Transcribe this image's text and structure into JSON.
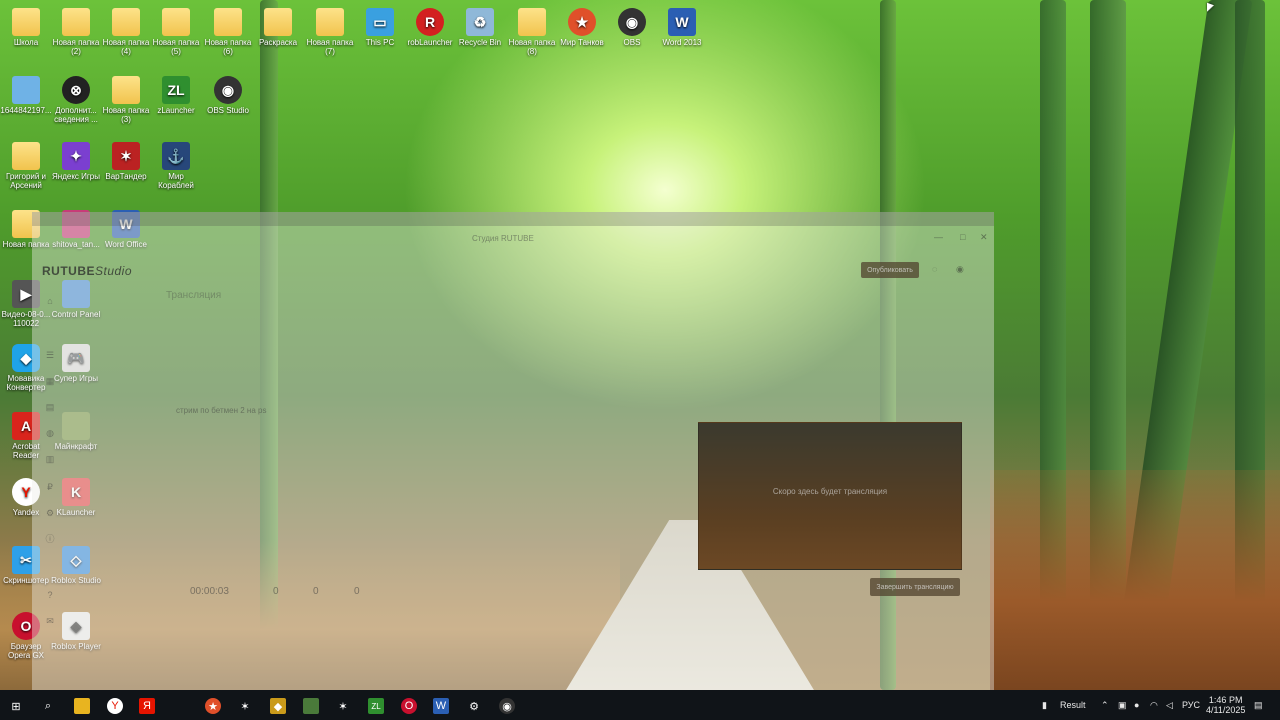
{
  "desktop": {
    "icons_row1": [
      {
        "label": "Школа",
        "icon": "folder-icon"
      },
      {
        "label": "Новая папка (2)",
        "icon": "folder-icon"
      },
      {
        "label": "Новая папка (4)",
        "icon": "folder-icon"
      },
      {
        "label": "Новая папка (5)",
        "icon": "folder-icon"
      },
      {
        "label": "Новая папка (6)",
        "icon": "folder-icon"
      },
      {
        "label": "Раскраска",
        "icon": "folder-icon"
      },
      {
        "label": "Новая папка (7)",
        "icon": "folder-icon"
      },
      {
        "label": "This PC",
        "icon": "computer-icon"
      },
      {
        "label": "robLauncher",
        "icon": "launcher-icon"
      },
      {
        "label": "Recycle Bin",
        "icon": "recycle-bin-icon"
      },
      {
        "label": "Новая папка (8)",
        "icon": "folder-icon"
      },
      {
        "label": "Мир Танков",
        "icon": "tank-icon"
      },
      {
        "label": "OBS",
        "icon": "obs-icon"
      },
      {
        "label": "Word 2013",
        "icon": "word-icon"
      }
    ],
    "icons_row2": [
      {
        "label": "1644842197...",
        "icon": "image-icon"
      },
      {
        "label": "Дополнит... сведения ...",
        "icon": "settings-icon"
      },
      {
        "label": "Новая папка (3)",
        "icon": "folder-icon"
      },
      {
        "label": "zLauncher",
        "icon": "zl-icon"
      },
      {
        "label": "OBS Studio",
        "icon": "obs-icon"
      }
    ],
    "icons_row3": [
      {
        "label": "Григорий и Арсений",
        "icon": "folder-icon"
      },
      {
        "label": "Яндекс Игры",
        "icon": "games-icon"
      },
      {
        "label": "ВарТандер",
        "icon": "war-thunder-icon"
      },
      {
        "label": "Мир Кораблей",
        "icon": "ships-icon"
      }
    ],
    "icons_row4": [
      {
        "label": "Новая папка",
        "icon": "folder-icon"
      },
      {
        "label": "shitova_tan...",
        "icon": "image-icon"
      },
      {
        "label": "Word Office",
        "icon": "word-icon"
      }
    ],
    "icons_col": [
      {
        "label": "Видео-08-0... 110022",
        "icon": "video-icon"
      },
      {
        "label": "Control Panel",
        "icon": "control-panel-icon"
      },
      {
        "label": "Мовавика Конвертер",
        "icon": "movavi-icon"
      },
      {
        "label": "Супер Игры",
        "icon": "gamepad-icon"
      },
      {
        "label": "Acrobat Reader",
        "icon": "acrobat-icon"
      },
      {
        "label": "Майнкрафт",
        "icon": "minecraft-icon"
      },
      {
        "label": "Yandex",
        "icon": "yandex-icon"
      },
      {
        "label": "KLauncher",
        "icon": "klauncher-icon"
      },
      {
        "label": "Скриншотер",
        "icon": "screenshot-icon"
      },
      {
        "label": "Roblox Studio",
        "icon": "roblox-studio-icon"
      },
      {
        "label": "Браузер Opera GX",
        "icon": "opera-gx-icon"
      },
      {
        "label": "Roblox Player",
        "icon": "roblox-player-icon"
      }
    ]
  },
  "window": {
    "title": "Студия RUTUBE",
    "brand": "RUTUBE",
    "brand_suffix": "Studio",
    "page_heading": "Трансляция",
    "stream_title": "стрим по бетмен 2 на ps",
    "preview_text": "Скоро здесь будет трансляция",
    "end_button": "Завершить трансляцию",
    "publish_button": "Опубликовать",
    "timer": "00:00:03",
    "counters": [
      "0",
      "0",
      "0"
    ]
  },
  "taskbar": {
    "tray_app": "Result",
    "language": "РУС",
    "time": "1:46 PM",
    "date": "4/11/2025"
  }
}
